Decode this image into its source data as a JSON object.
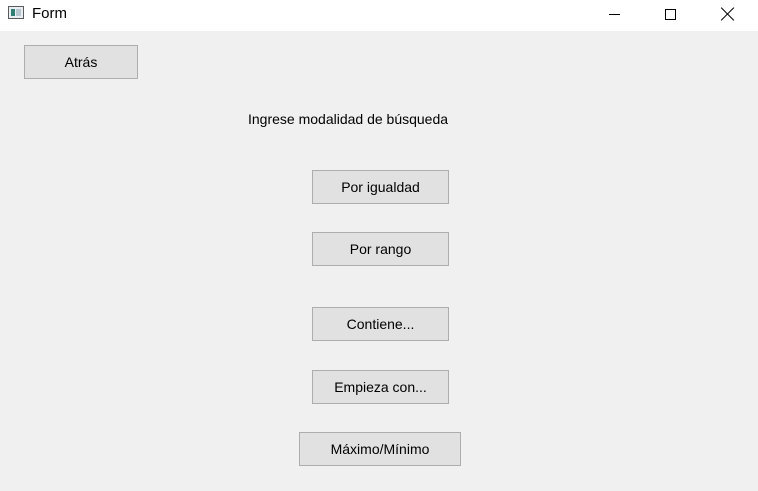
{
  "window": {
    "title": "Form",
    "icon": "app-form-icon"
  },
  "caption_buttons": {
    "minimize": "minimize-icon",
    "maximize": "maximize-icon",
    "close": "close-icon"
  },
  "back_button": {
    "label": "Atrás"
  },
  "prompt": {
    "text": "Ingrese modalidad de búsqueda"
  },
  "search_modes": [
    {
      "label": "Por igualdad"
    },
    {
      "label": "Por rango"
    },
    {
      "label": "Contiene..."
    },
    {
      "label": "Empieza con..."
    },
    {
      "label": "Máximo/Mínimo"
    }
  ]
}
